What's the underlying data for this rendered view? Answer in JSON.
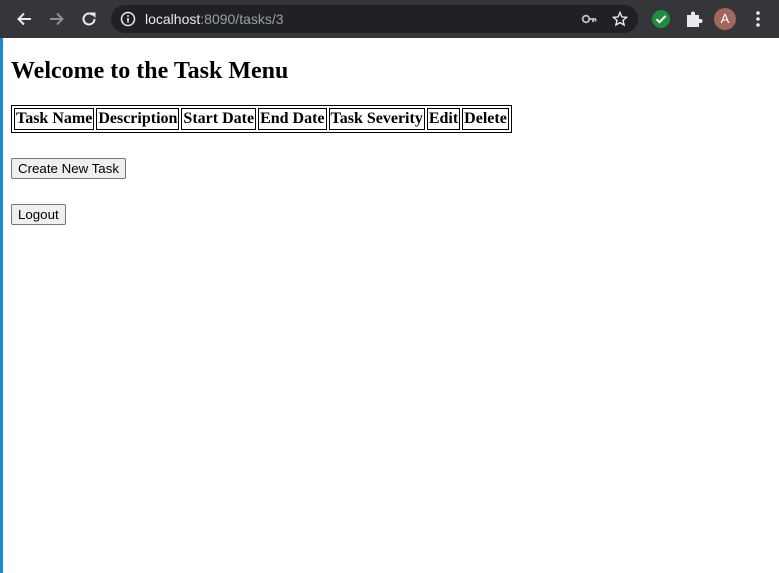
{
  "browser": {
    "url_host": "localhost",
    "url_path": ":8090/tasks/3",
    "profile_initial": "A",
    "icons": [
      "back-icon",
      "forward-icon",
      "reload-icon",
      "site-info-icon",
      "key-icon",
      "star-icon",
      "extension-check-icon",
      "puzzle-icon",
      "menu-icon"
    ]
  },
  "page": {
    "title": "Welcome to the Task Menu",
    "table": {
      "headers": [
        "Task Name",
        "Description",
        "Start Date",
        "End Date",
        "Task Severity",
        "Edit",
        "Delete"
      ]
    },
    "create_button": "Create New Task",
    "logout_button": "Logout"
  },
  "colors": {
    "chrome_toolbar": "#35363a",
    "omnibox": "#202124",
    "extension_green": "#1e8e3e",
    "avatar": "#a1675c",
    "left_edge_accent": "#1e88d8"
  }
}
